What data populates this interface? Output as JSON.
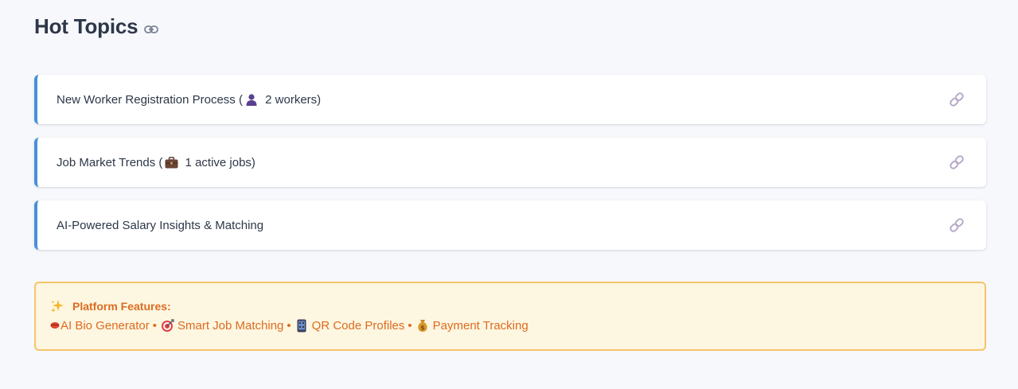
{
  "header": {
    "title": "Hot Topics",
    "link_icon": "link-icon"
  },
  "topics": [
    {
      "label_before": "New Worker Registration Process (",
      "icon": "person-icon",
      "label_after": " 2 workers)",
      "link_icon": "chain-link-icon"
    },
    {
      "label_before": "Job Market Trends (",
      "icon": "briefcase-icon",
      "label_after": " 1 active jobs)",
      "link_icon": "chain-link-icon"
    },
    {
      "label_before": "AI-Powered Salary Insights & Matching",
      "icon": "",
      "label_after": "",
      "link_icon": "chain-link-icon"
    }
  ],
  "features": {
    "title_icon": "sparkles-icon",
    "title": "Platform Features:",
    "items": [
      {
        "icon": "lips-icon",
        "label": "AI Bio Generator"
      },
      {
        "icon": "target-icon",
        "label": "Smart Job Matching"
      },
      {
        "icon": "mobile-phone-icon",
        "label": "QR Code Profiles"
      },
      {
        "icon": "money-bag-icon",
        "label": "Payment Tracking"
      }
    ],
    "separator": "•"
  },
  "colors": {
    "accent_border": "#4a90d9",
    "features_bg": "#fdf6e0",
    "features_border": "#f6c46a",
    "features_text": "#dd6b20",
    "link_icon": "#b7a9c9"
  }
}
